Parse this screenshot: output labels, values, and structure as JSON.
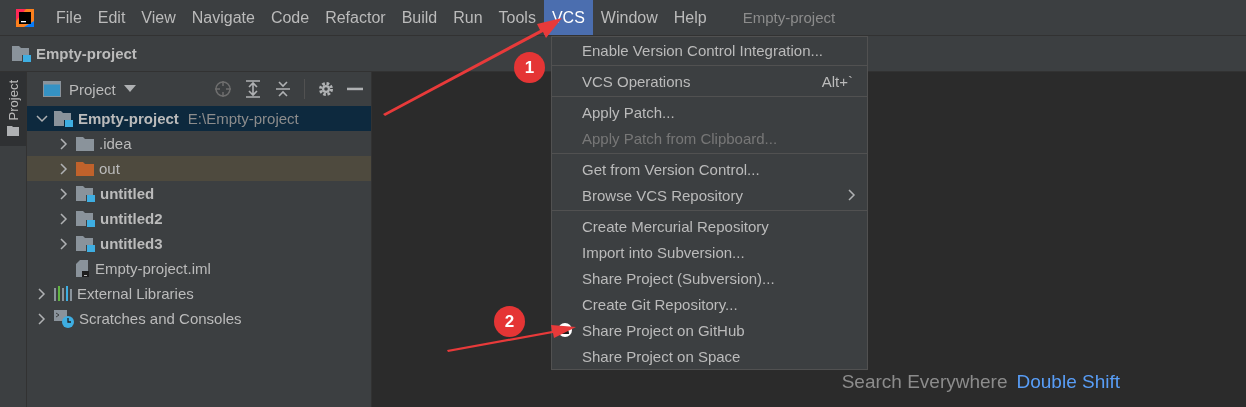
{
  "menu_bar": {
    "items": [
      {
        "label": "File",
        "selected": false
      },
      {
        "label": "Edit",
        "selected": false
      },
      {
        "label": "View",
        "selected": false
      },
      {
        "label": "Navigate",
        "selected": false
      },
      {
        "label": "Code",
        "selected": false
      },
      {
        "label": "Refactor",
        "selected": false
      },
      {
        "label": "Build",
        "selected": false
      },
      {
        "label": "Run",
        "selected": false
      },
      {
        "label": "Tools",
        "selected": false
      },
      {
        "label": "VCS",
        "selected": true
      },
      {
        "label": "Window",
        "selected": false
      },
      {
        "label": "Help",
        "selected": false
      }
    ],
    "project_title": "Empty-project"
  },
  "nav_bar": {
    "crumb": "Empty-project"
  },
  "side_stripe": {
    "tab": "Project",
    "selected": true
  },
  "project_panel": {
    "title": "Project",
    "tree": [
      {
        "label": "Empty-project",
        "path": "E:\\Empty-project",
        "kind": "module",
        "expanded": true,
        "selected": true,
        "children": [
          {
            "label": ".idea",
            "kind": "folder",
            "expanded": false,
            "selected": false
          },
          {
            "label": "out",
            "kind": "excluded",
            "expanded": false,
            "selected": false
          },
          {
            "label": "untitled",
            "kind": "module",
            "expanded": false,
            "selected": false
          },
          {
            "label": "untitled2",
            "kind": "module",
            "expanded": false,
            "selected": false
          },
          {
            "label": "untitled3",
            "kind": "module",
            "expanded": false,
            "selected": false
          },
          {
            "label": "Empty-project.iml",
            "kind": "file",
            "selected": false
          }
        ]
      },
      {
        "label": "External Libraries",
        "kind": "libraries",
        "expanded": false,
        "selected": false
      },
      {
        "label": "Scratches and Consoles",
        "kind": "scratches",
        "expanded": false,
        "selected": false
      }
    ]
  },
  "vcs_menu": {
    "groups": [
      [
        {
          "label": "Enable Version Control Integration...",
          "disabled": false
        }
      ],
      [
        {
          "label": "VCS Operations",
          "shortcut": "Alt+`",
          "disabled": false
        }
      ],
      [
        {
          "label": "Apply Patch...",
          "disabled": false
        },
        {
          "label": "Apply Patch from Clipboard...",
          "disabled": true
        }
      ],
      [
        {
          "label": "Get from Version Control...",
          "disabled": false
        },
        {
          "label": "Browse VCS Repository",
          "disabled": false,
          "has_submenu": true
        }
      ],
      [
        {
          "label": "Create Mercurial Repository",
          "disabled": false
        },
        {
          "label": "Import into Subversion...",
          "disabled": false
        },
        {
          "label": "Share Project (Subversion)...",
          "disabled": false
        },
        {
          "label": "Create Git Repository...",
          "disabled": false
        },
        {
          "label": "Share Project on GitHub",
          "disabled": false,
          "has_icon": true
        },
        {
          "label": "Share Project on Space",
          "disabled": false
        }
      ]
    ]
  },
  "editor": {
    "hint": "Search Everywhere",
    "shortcut": "Double Shift"
  },
  "annotations": [
    {
      "label": "1"
    },
    {
      "label": "2"
    }
  ]
}
